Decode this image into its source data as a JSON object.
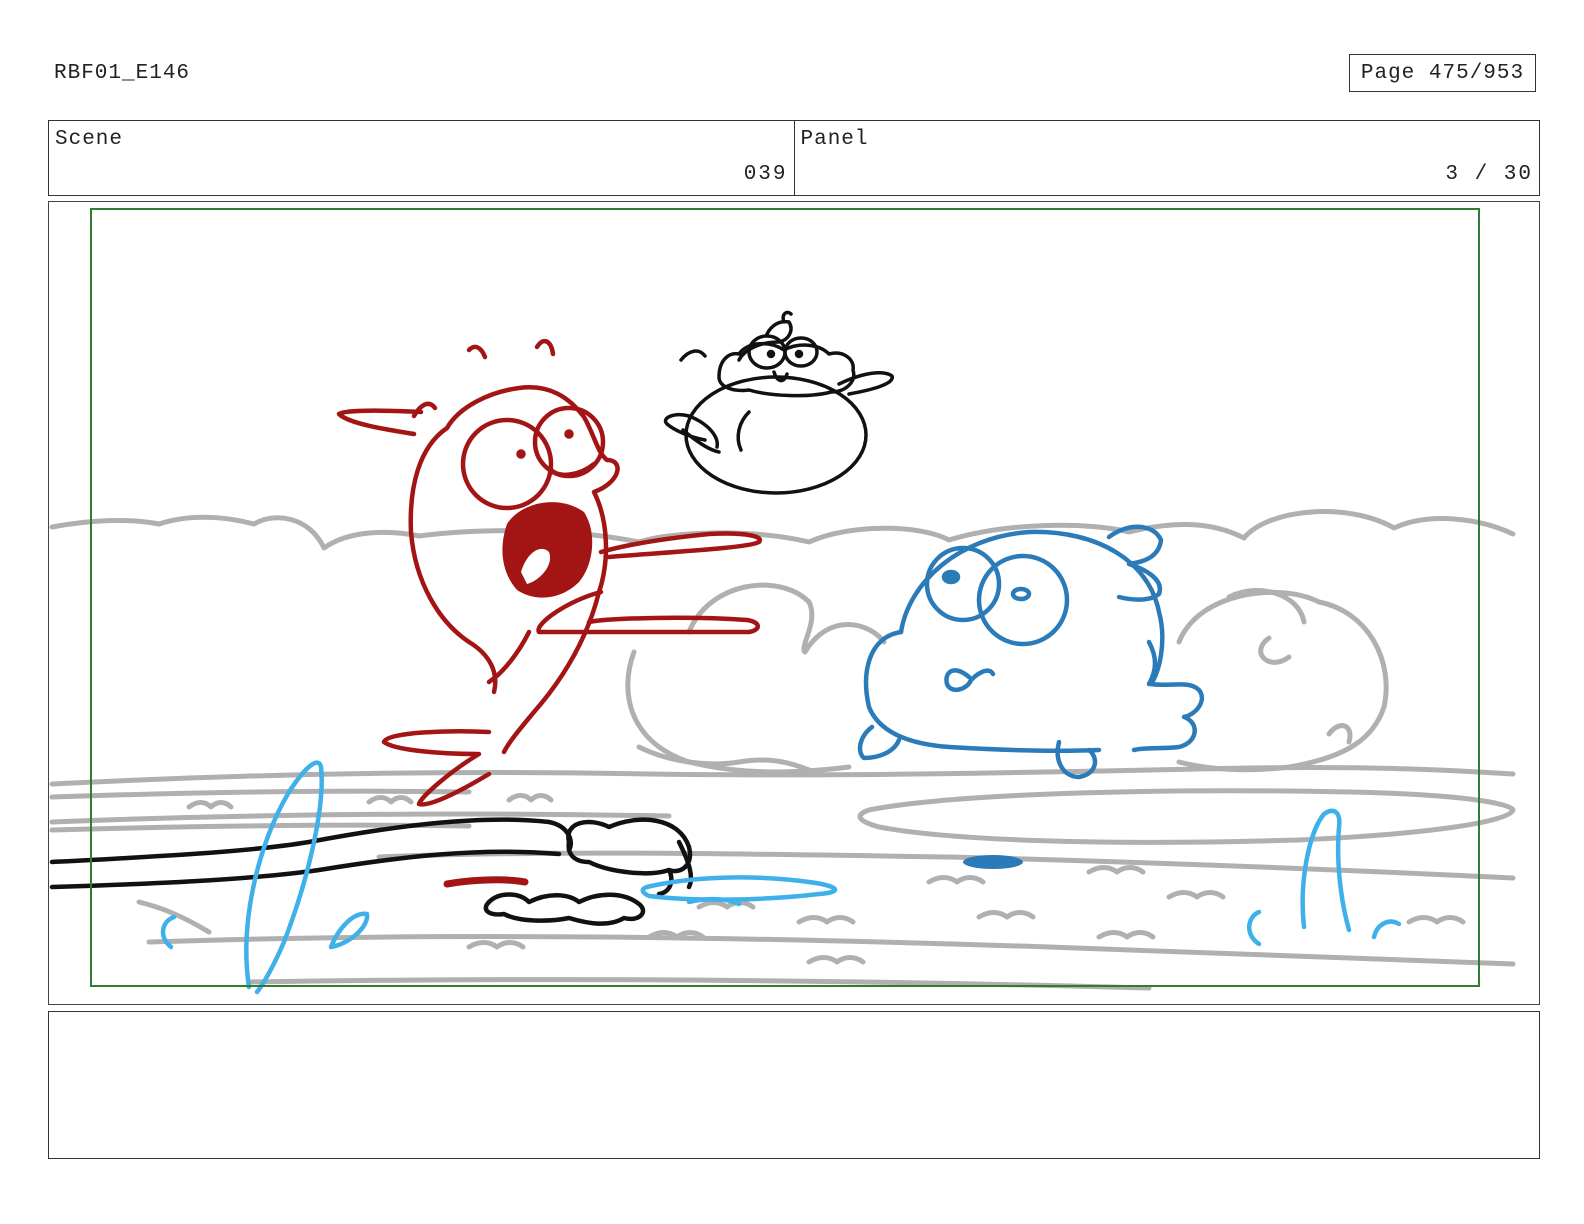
{
  "header": {
    "doc_id": "RBF01_E146",
    "page_label": "Page 475/953"
  },
  "info": {
    "scene_label": "Scene",
    "scene_value": "039",
    "panel_label": "Panel",
    "panel_value": "3 / 30"
  },
  "colors": {
    "safe_area": "#2e7d32",
    "red_character": "#a31515",
    "blue_character": "#2b7bb9",
    "light_blue": "#3fb0ea",
    "background_gray": "#b0b0b0",
    "ink": "#111111"
  },
  "notes": {
    "text": ""
  }
}
